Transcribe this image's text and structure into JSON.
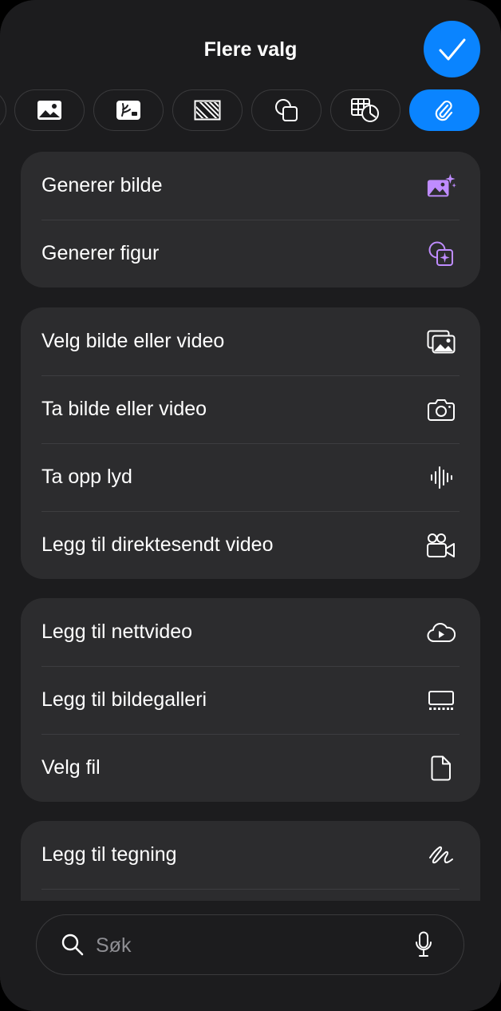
{
  "header": {
    "title": "Flere valg"
  },
  "toolbar": {
    "chips": [
      {
        "icon": "partial-chip-edge"
      },
      {
        "icon": "image-icon"
      },
      {
        "icon": "image-edit-icon"
      },
      {
        "icon": "hatched-frame-icon"
      },
      {
        "icon": "shapes-icon"
      },
      {
        "icon": "table-chart-icon"
      },
      {
        "icon": "paperclip-icon",
        "selected": true
      }
    ]
  },
  "groups": [
    {
      "items": [
        {
          "label": "Generer bilde",
          "icon": "image-sparkle-icon"
        },
        {
          "label": "Generer figur",
          "icon": "shape-sparkle-icon"
        }
      ]
    },
    {
      "items": [
        {
          "label": "Velg bilde eller video",
          "icon": "photos-icon"
        },
        {
          "label": "Ta bilde eller video",
          "icon": "camera-icon"
        },
        {
          "label": "Ta opp lyd",
          "icon": "waveform-icon"
        },
        {
          "label": "Legg til direktesendt video",
          "icon": "video-camera-icon"
        }
      ]
    },
    {
      "items": [
        {
          "label": "Legg til nettvideo",
          "icon": "cloud-play-icon"
        },
        {
          "label": "Legg til bildegalleri",
          "icon": "gallery-icon"
        },
        {
          "label": "Velg fil",
          "icon": "document-icon"
        }
      ]
    },
    {
      "items": [
        {
          "label": "Legg til tegning",
          "icon": "scribble-icon"
        }
      ]
    }
  ],
  "search": {
    "placeholder": "Søk"
  },
  "colors": {
    "accent": "#0a84ff",
    "sparkle": "#bf8cff",
    "sheet": "#1c1c1e",
    "group": "#2c2c2e"
  }
}
